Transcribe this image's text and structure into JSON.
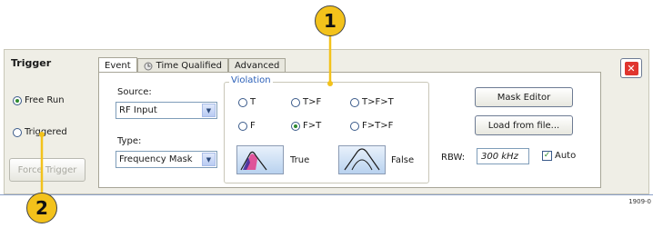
{
  "panel": {
    "title": "Trigger"
  },
  "trigger_mode": {
    "options": [
      {
        "label": "Free Run",
        "selected": true
      },
      {
        "label": "Triggered",
        "selected": false
      }
    ],
    "force_trigger_label": "Force Trigger"
  },
  "tabs": [
    {
      "label": "Event",
      "active": true
    },
    {
      "label": "Time Qualified",
      "active": false
    },
    {
      "label": "Advanced",
      "active": false
    }
  ],
  "event": {
    "source_label": "Source:",
    "source_value": "RF Input",
    "type_label": "Type:",
    "type_value": "Frequency Mask"
  },
  "violation": {
    "title": "Violation",
    "options": [
      {
        "label": "T",
        "selected": false
      },
      {
        "label": "T>F",
        "selected": false
      },
      {
        "label": "T>F>T",
        "selected": false
      },
      {
        "label": "F",
        "selected": false
      },
      {
        "label": "F>T",
        "selected": true
      },
      {
        "label": "F>T>F",
        "selected": false
      }
    ],
    "true_label": "True",
    "false_label": "False"
  },
  "mask": {
    "editor_label": "Mask Editor",
    "load_label": "Load from file..."
  },
  "rbw": {
    "label": "RBW:",
    "value": "300 kHz",
    "auto_label": "Auto",
    "auto_checked": true
  },
  "callouts": [
    "1",
    "2"
  ],
  "figure_ref": "1909-0",
  "colors": {
    "panel_bg": "#efeee6",
    "callout": "#f3c21b",
    "close": "#e0352f",
    "accent": "#2a5fb8"
  },
  "icons": {
    "close": "close-icon",
    "tab": "clock-icon"
  }
}
